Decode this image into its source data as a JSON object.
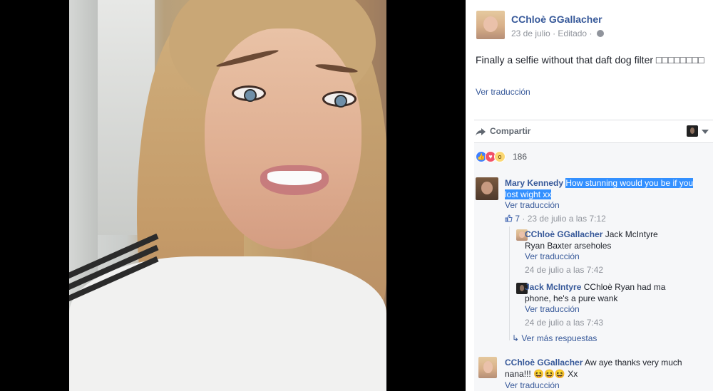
{
  "post": {
    "author": "CChloè GGallacher",
    "date": "23 de julio",
    "edited": "Editado",
    "separator": "·",
    "text": "Finally a selfie without that daft dog filter □□□□□□□□",
    "translate": "Ver traducción"
  },
  "actions": {
    "share_label": "Compartir"
  },
  "reactions": {
    "count": "186"
  },
  "comments": [
    {
      "author": "Mary Kennedy",
      "text": "How stunning would you be if you lost wight xx",
      "translate": "Ver traducción",
      "likes": "7",
      "time": "23 de julio a las 7:12"
    }
  ],
  "replies": [
    {
      "author": "CChloè GGallacher",
      "text": "Jack McIntyre Ryan Baxter arseholes",
      "translate": "Ver traducción",
      "time": "24 de julio a las 7:42"
    },
    {
      "author": "Jack McIntyre",
      "text": "CChloè Ryan had ma phone, he's a pure wank",
      "translate": "Ver traducción",
      "time": "24 de julio a las 7:43"
    }
  ],
  "more_replies": "Ver más respuestas",
  "last_comment": {
    "author": "CChloè GGallacher",
    "text": "Aw aye thanks very much nana!!! 😆😆😆 Xx",
    "translate": "Ver traducción"
  }
}
